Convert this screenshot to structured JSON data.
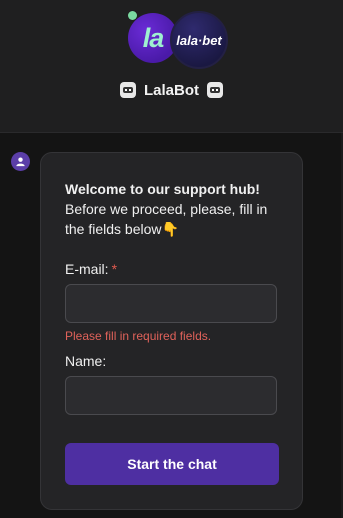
{
  "header": {
    "logo_left_text": "la",
    "logo_right_text": "lala·bet",
    "bot_name": "LalaBot"
  },
  "form": {
    "intro_title": "Welcome to our support hub!",
    "intro_text": "Before we proceed, please, fill in the fields below👇",
    "email_label": "E-mail:",
    "required_marker": "*",
    "email_value": "",
    "error_text": "Please fill in required fields.",
    "name_label": "Name:",
    "name_value": "",
    "submit_label": "Start the chat"
  },
  "colors": {
    "accent": "#4e2fa2",
    "error": "#e0625a",
    "online": "#7ad9a0"
  }
}
